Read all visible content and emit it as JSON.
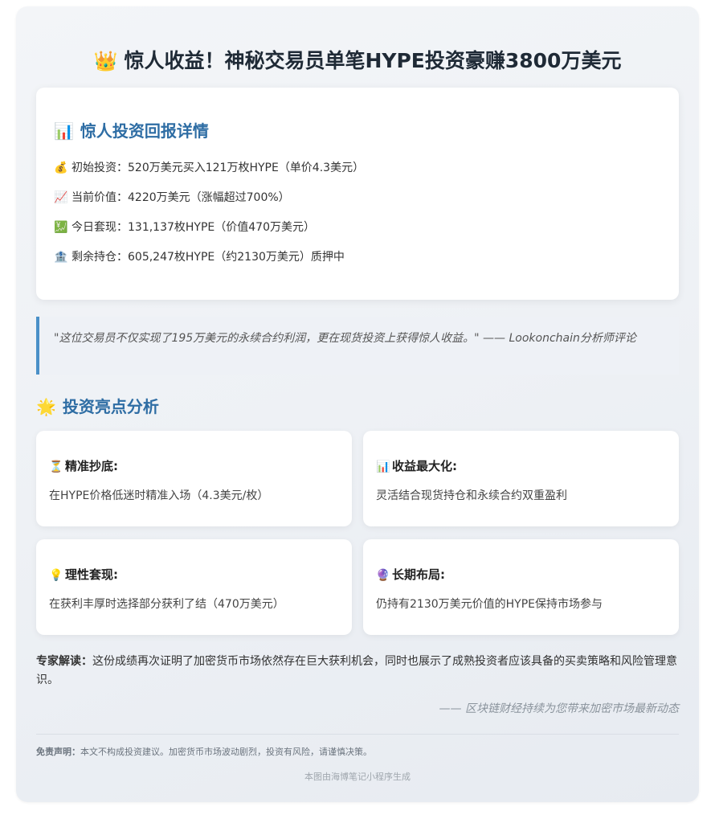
{
  "title": {
    "emoji": "👑",
    "text": "惊人收益！神秘交易员单笔HYPE投资豪赚3800万美元"
  },
  "details": {
    "emoji": "📊",
    "heading": "惊人投资回报详情",
    "items": [
      {
        "emoji": "💰",
        "text": "初始投资：520万美元买入121万枚HYPE（单价4.3美元）"
      },
      {
        "emoji": "📈",
        "text": "当前价值：4220万美元（涨幅超过700%）"
      },
      {
        "emoji": "💹",
        "text": "今日套现：131,137枚HYPE（价值470万美元）"
      },
      {
        "emoji": "🏦",
        "text": "剩余持仓：605,247枚HYPE（约2130万美元）质押中"
      }
    ]
  },
  "quote": "\"这位交易员不仅实现了195万美元的永续合约利润，更在现货投资上获得惊人收益。\" —— Lookonchain分析师评论",
  "highlights": {
    "emoji": "🌟",
    "heading": "投资亮点分析",
    "cards": [
      {
        "emoji": "⏳",
        "title": "精准抄底:",
        "desc": "在HYPE价格低迷时精准入场（4.3美元/枚）"
      },
      {
        "emoji": "📊",
        "title": "收益最大化:",
        "desc": "灵活结合现货持仓和永续合约双重盈利"
      },
      {
        "emoji": "💡",
        "title": "理性套现:",
        "desc": "在获利丰厚时选择部分获利了结（470万美元）"
      },
      {
        "emoji": "🔮",
        "title": "长期布局:",
        "desc": "仍持有2130万美元价值的HYPE保持市场参与"
      }
    ]
  },
  "expert": {
    "label": "专家解读：",
    "text": "这份成绩再次证明了加密货币市场依然存在巨大获利机会，同时也展示了成熟投资者应该具备的买卖策略和风险管理意识。"
  },
  "signature": "—— 区块链财经持续为您带来加密市场最新动态",
  "disclaimer": {
    "label": "免责声明：",
    "text": "本文不构成投资建议。加密货币市场波动剧烈，投资有风险，请谨慎决策。"
  },
  "footer": "本图由海博笔记小程序生成"
}
